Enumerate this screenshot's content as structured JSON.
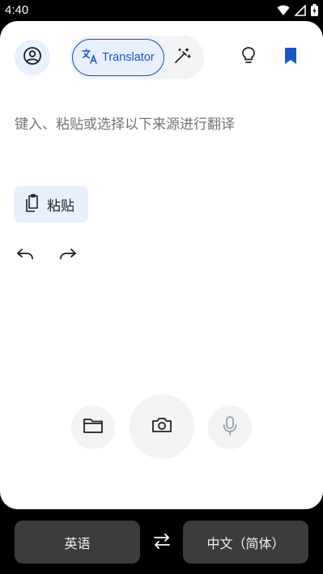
{
  "status_bar": {
    "time": "4:40",
    "icons": [
      "wifi-icon",
      "signal-icon",
      "battery-icon"
    ]
  },
  "header": {
    "account_icon": "account-circle-icon",
    "translator_label": "Translator",
    "translator_icon": "translate-icon",
    "magic_icon": "magic-wand-icon",
    "tips_icon": "lightbulb-icon",
    "saved_icon": "bookmark-icon"
  },
  "editor": {
    "placeholder": "键入、粘贴或选择以下来源进行翻译",
    "paste_label": "粘贴",
    "undo_icon": "undo-icon",
    "redo_icon": "redo-icon"
  },
  "sources": {
    "folder_icon": "folder-icon",
    "camera_icon": "camera-icon",
    "mic_icon": "microphone-icon"
  },
  "languages": {
    "source": "英语",
    "target": "中文（简体）",
    "swap_icon": "swap-icon"
  },
  "colors": {
    "accent": "#1a56c9",
    "chip_bg": "#e8f0fe",
    "lang_bar": "#3c3c3c"
  }
}
